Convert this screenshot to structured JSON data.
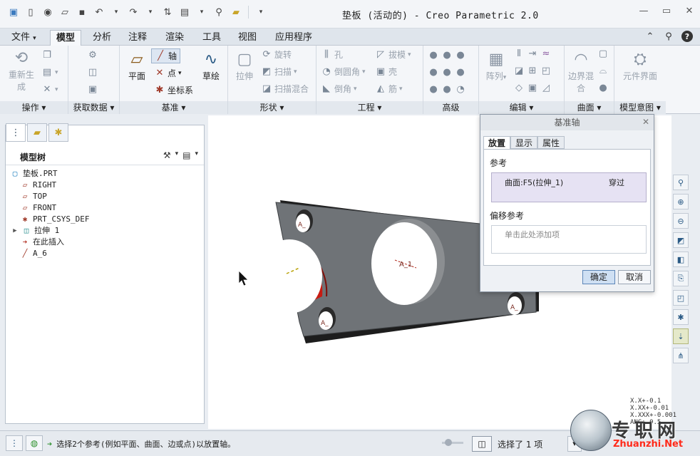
{
  "window": {
    "title": "垫板 (活动的) - Creo Parametric 2.0"
  },
  "quick_access": [
    "app-icon",
    "new-icon",
    "open-icon",
    "open-folder-icon",
    "save-icon",
    "undo-icon",
    "redo-icon",
    "regenerate-icon",
    "windows-icon",
    "search-icon",
    "folder-icon",
    "more-icon"
  ],
  "tabs": [
    "文件",
    "模型",
    "分析",
    "注释",
    "渲染",
    "工具",
    "视图",
    "应用程序"
  ],
  "active_tab": "模型",
  "ribbon": {
    "operations": {
      "label": "操作",
      "regenerate": "重新生成"
    },
    "get_data": {
      "label": "获取数据"
    },
    "datum": {
      "label": "基准",
      "plane": "平面",
      "axis": "轴",
      "point": "点",
      "csys": "坐标系",
      "sketch": "草绘"
    },
    "shapes": {
      "label": "形状",
      "extrude": "拉伸",
      "revolve": "旋转",
      "sweep": "扫描",
      "swept_blend": "扫描混合"
    },
    "engineering": {
      "label": "工程",
      "hole": "孔",
      "round": "倒圆角",
      "chamfer": "倒角",
      "draft": "拔模",
      "shell": "壳",
      "rib": "筋"
    },
    "advanced": {
      "label": "高级"
    },
    "editing": {
      "label": "编辑",
      "pattern": "阵列"
    },
    "surfaces": {
      "label": "曲面",
      "boundary_blend": "边界混合"
    },
    "model_intent": {
      "label": "模型意图",
      "component_interface": "元件界面"
    }
  },
  "model_tree": {
    "header": "模型树",
    "items": [
      {
        "label": "垫板.PRT"
      },
      {
        "label": "RIGHT"
      },
      {
        "label": "TOP"
      },
      {
        "label": "FRONT"
      },
      {
        "label": "PRT_CSYS_DEF"
      },
      {
        "label": "拉伸 1"
      },
      {
        "label": "在此插入"
      },
      {
        "label": "A_6"
      }
    ]
  },
  "dialog": {
    "title": "基准轴",
    "tabs": [
      "放置",
      "显示",
      "属性"
    ],
    "references_label": "参考",
    "reference": {
      "item": "曲面:F5(拉伸_1)",
      "constraint": "穿过"
    },
    "offset_label": "偏移参考",
    "offset_placeholder": "单击此处添加项",
    "ok": "确定",
    "cancel": "取消"
  },
  "canvas": {
    "labels": [
      "A_1",
      "A_",
      "A_",
      "A_"
    ]
  },
  "status": {
    "message": "选择2个参考(例如平面、曲面、边或点)以放置轴。",
    "selection": "选择了 1 项"
  },
  "tolerance": [
    "X.X+-0.1",
    "X.XX+-0.01",
    "X.XXX+-0.001",
    "ANG+-0.5"
  ],
  "watermark": {
    "cn": "专职网",
    "en": "Zhuanzhi.Net"
  }
}
